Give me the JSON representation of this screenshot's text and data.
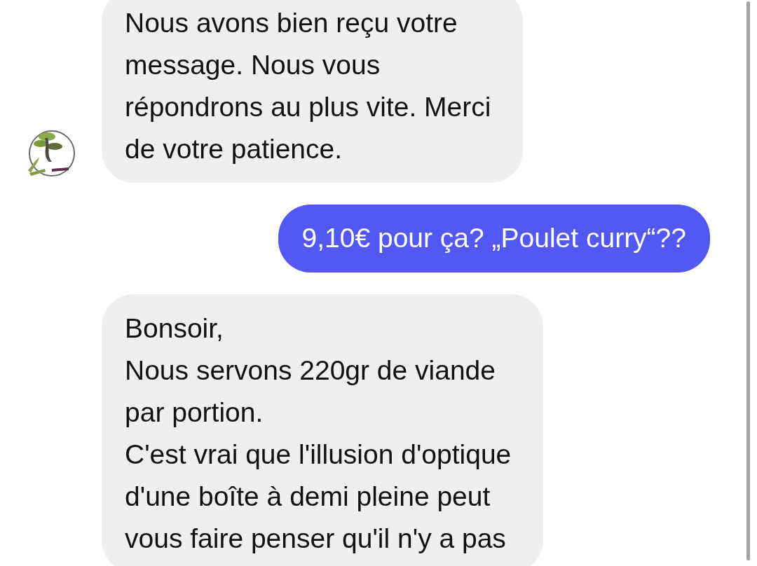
{
  "messages": [
    {
      "kind": "incoming",
      "avatar": true,
      "text": "Nous avons bien reçu votre\nmessage. Nous vous\nrépondrons au plus vite. Merci\nde votre patience."
    },
    {
      "kind": "outgoing",
      "text": "9,10€ pour ça? „Poulet curry“??"
    },
    {
      "kind": "incoming",
      "avatar": false,
      "text": "Bonsoir,\nNous servons 220gr de viande\npar portion.\nC'est vrai que l'illusion d'optique\nd'une boîte à demi pleine peut\nvous faire penser qu'il n'y a pas"
    }
  ]
}
